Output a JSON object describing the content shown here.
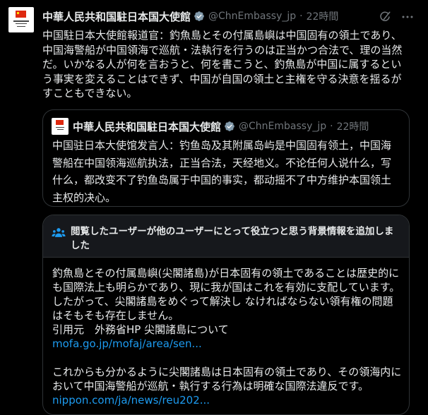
{
  "post": {
    "author_name": "中華人民共和国駐日本国大使館",
    "author_handle": "@ChnEmbassy_jp",
    "time": "22時間",
    "text": "中国駐日本大使館報道官：釣魚島とその付属島嶼は中国固有の領土であり、中国海警船が中国領海で巡航・法執行を行うのは正当かつ合法で、理の当然だ。いかなる人が何を言おうと、何を書こうと、釣魚島が中国に属するという事実を変えることはできず、中国が自国の領土と主権を守る決意を揺るがすこともできない。"
  },
  "quote": {
    "author_name": "中華人民共和国駐日本国大使館",
    "author_handle": "@ChnEmbassy_jp",
    "time": "22時間",
    "text": "中国驻日本大使馆发言人：钓鱼岛及其附属岛屿是中国固有领土，中国海警船在中国领海巡航执法，正当合法，天经地义。不论任何人说什么，写什么，都改变不了钓鱼岛属于中国的事实，都动摇不了中方维护本国领土主权的决心。"
  },
  "note": {
    "title": "閲覧したユーザーが他のユーザーにとって役立つと思う背景情報を追加しました",
    "paragraph1": "釣魚島とその付属島嶼(尖閣諸島)が日本固有の領土であることは歴史的にも国際法上も明らかであり、現に我が国はこれを有効に支配しています。したがって、尖閣諸島をめぐって解決し なければならない領有権の問題はそもそも存在しません。",
    "citation": "引用元　外務省HP 尖閣諸島について",
    "link1": "mofa.go.jp/mofaj/area/sen...",
    "paragraph2": "これからも分かるように尖閣諸島は日本固有の領土であり、その領海内において中国海警船が巡航・執行する行為は明確な国際法違反です。",
    "link2": "nippon.com/ja/news/reu202..."
  },
  "colors": {
    "background": "#000000",
    "text": "#e7e9ea",
    "secondary": "#71767b",
    "link": "#1d9bf0",
    "verified": "#829aab",
    "border": "#2f3336"
  },
  "icons": [
    "verified-badge-icon",
    "grok-icon",
    "more-icon",
    "people-icon"
  ]
}
